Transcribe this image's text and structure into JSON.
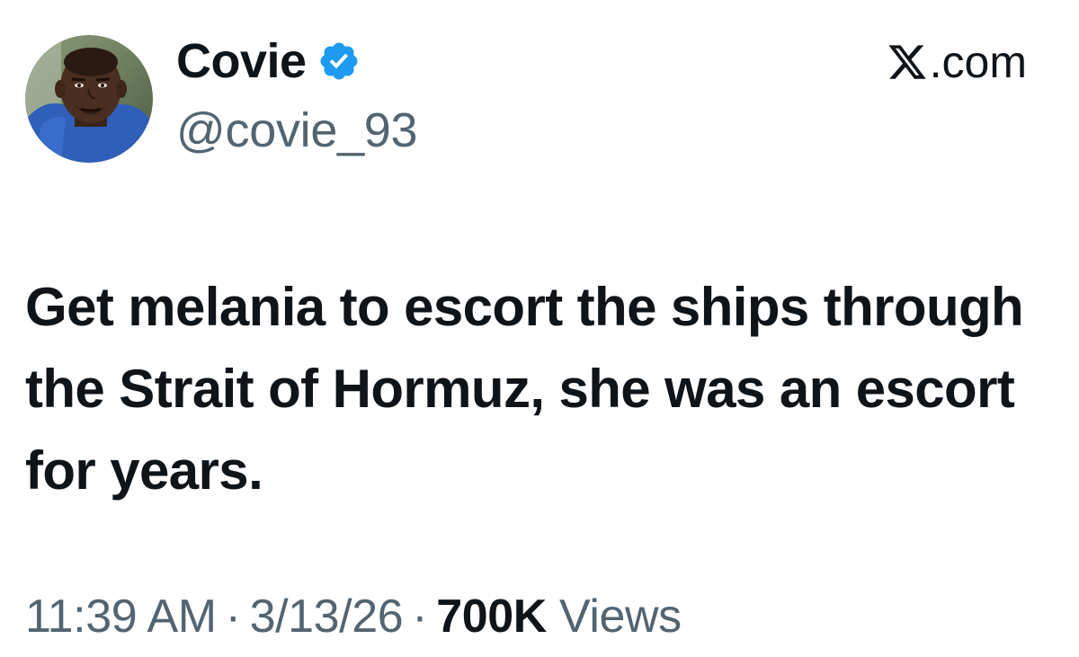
{
  "author": {
    "display_name": "Covie",
    "handle": "@covie_93",
    "verified_icon": "verified-badge-icon",
    "avatar_icon": "profile-photo"
  },
  "brand": {
    "x_icon": "x-logo-icon",
    "suffix": ".com"
  },
  "tweet": {
    "text": "Get melania to escort the ships through the Strait of Hormuz, she was an escort for years."
  },
  "meta": {
    "time": "11:39 AM",
    "separator": "·",
    "date": "3/13/26",
    "views_count": "700K",
    "views_label": "Views"
  },
  "colors": {
    "text_primary": "#0f1419",
    "text_secondary": "#536471",
    "verified_blue": "#1d9bf0",
    "background": "#ffffff"
  }
}
